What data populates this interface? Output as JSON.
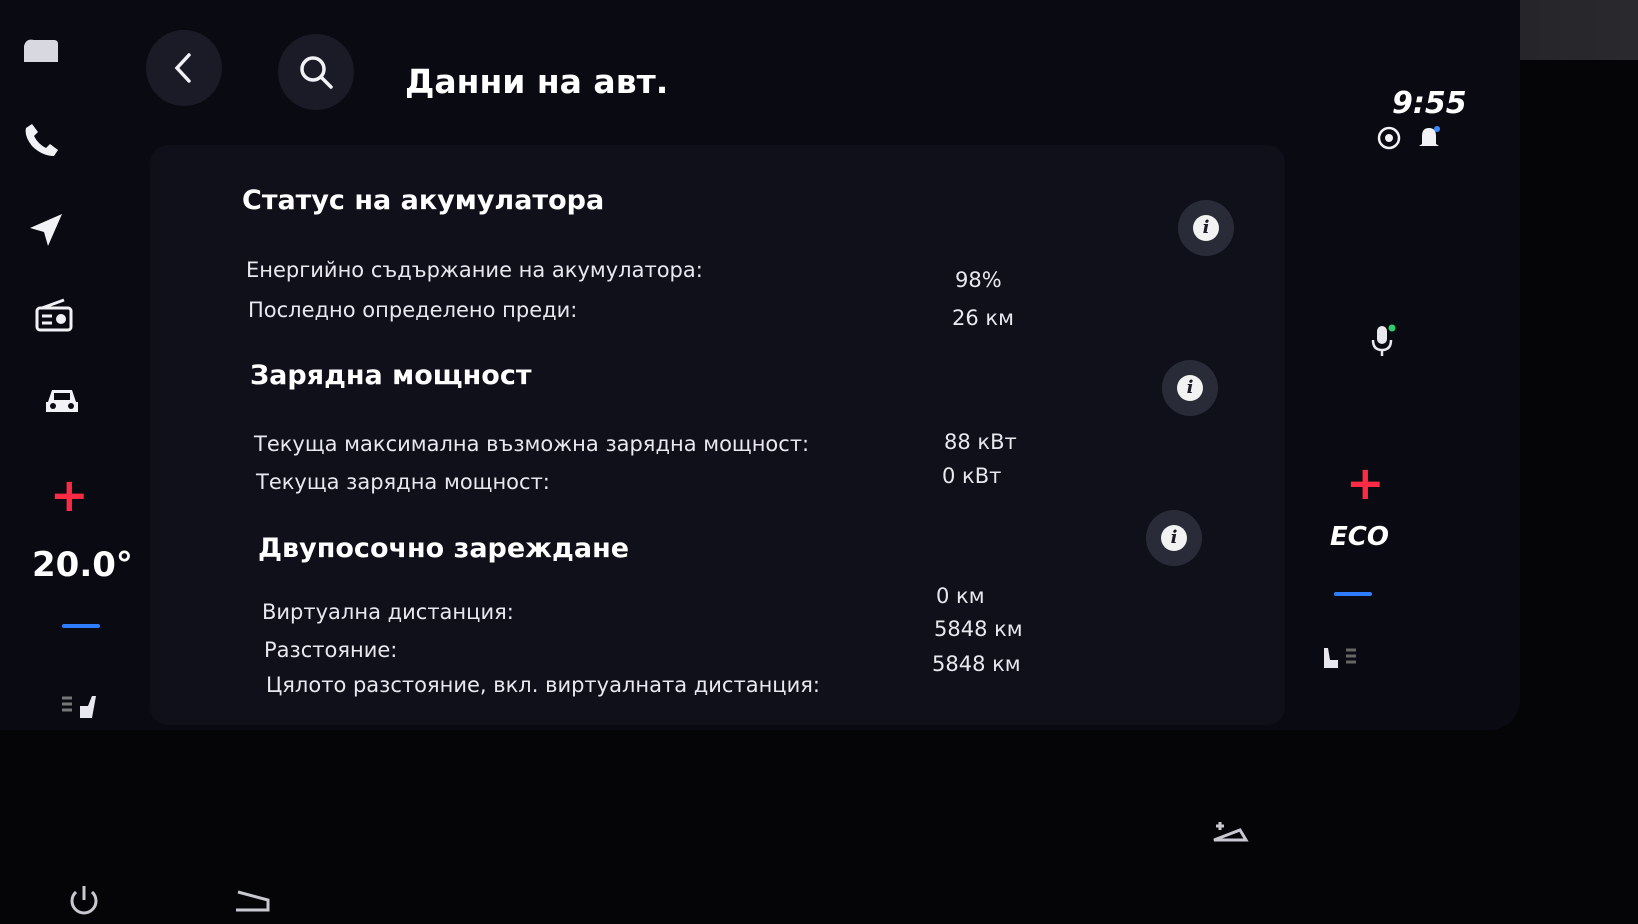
{
  "header": {
    "title": "Данни на авт.",
    "clock": "9:55"
  },
  "climate": {
    "temperature_left": "20.0°",
    "mode_right": "ECO"
  },
  "sections": [
    {
      "title": "Статус на акумулатора",
      "rows": [
        {
          "label": "Енергийно съдържание на акумулатора:",
          "value": "98%"
        },
        {
          "label": "Последно определено преди:",
          "value": "26 км"
        }
      ]
    },
    {
      "title": "Зарядна мощност",
      "rows": [
        {
          "label": "Текуща максимална възможна зарядна мощност:",
          "value": "88 кВт"
        },
        {
          "label": "Текуща зарядна мощност:",
          "value": "0 кВт"
        }
      ]
    },
    {
      "title": "Двупосочно зареждане",
      "rows": [
        {
          "label": "Виртуална дистанция:",
          "value": "0 км"
        },
        {
          "label": "Разстояние:",
          "value": "5848 км"
        },
        {
          "label": "Цялото разстояние, вкл. виртуалната дистанция:",
          "value": "5848 км"
        }
      ]
    }
  ],
  "info_glyph": "i",
  "colors": {
    "accent_plus": "#ff2a44",
    "accent_minus": "#2f7dff",
    "mic_dot": "#2ecc71"
  },
  "icons": [
    "home-icon",
    "phone-icon",
    "navigation-icon",
    "radio-icon",
    "car-icon",
    "back-icon",
    "search-icon",
    "connectivity-icon",
    "bell-icon",
    "microphone-icon",
    "seat-heat-icon",
    "power-icon",
    "wiper-icon",
    "fan-icon"
  ]
}
